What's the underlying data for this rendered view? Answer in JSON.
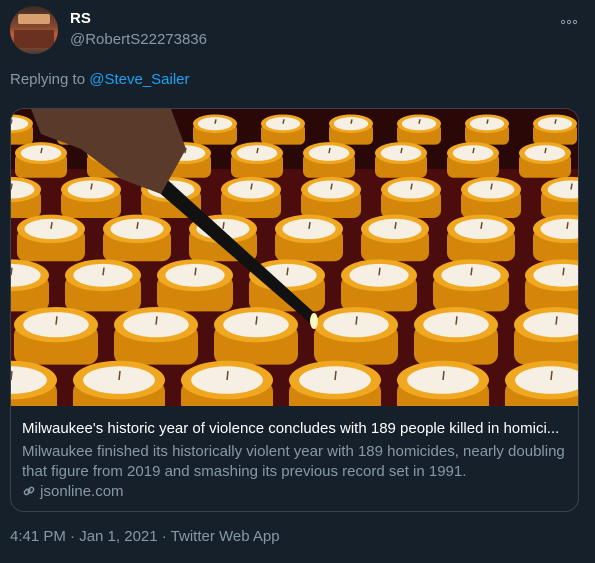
{
  "tweet": {
    "display_name": "RS",
    "handle": "@RobertS22273836",
    "more_icon": "more-horizontal-icon",
    "reply_prefix": "Replying to ",
    "reply_to": "@Steve_Sailer",
    "timestamp": "4:41 PM · Jan 1, 2021 · Twitter Web App"
  },
  "card": {
    "title": "Milwaukee's historic year of violence concludes with 189 people killed in homici...",
    "description": "Milwaukee finished its historically violent year with 189 homicides, nearly doubling that figure from 2019 and smashing its previous record set in 1991.",
    "domain": "jsonline.com",
    "link_icon": "link-icon"
  },
  "colors": {
    "background": "#15202b",
    "secondary_text": "#8899a6",
    "link": "#1da1f2",
    "border": "#38444d"
  }
}
